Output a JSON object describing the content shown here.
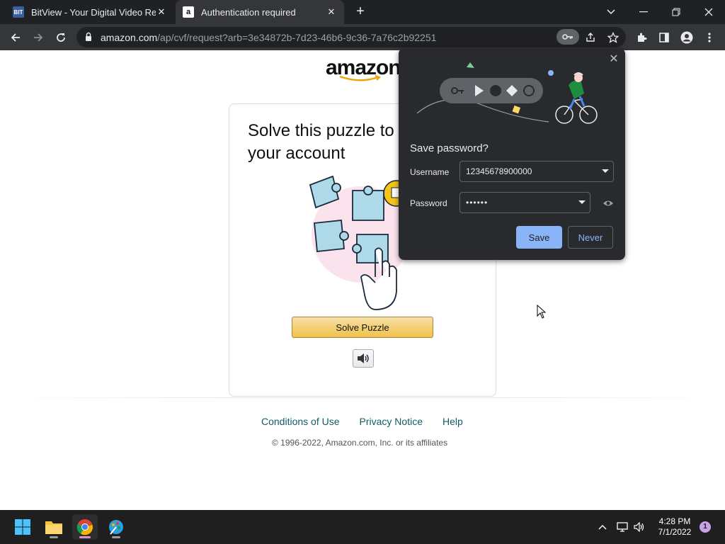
{
  "browser": {
    "tabs": [
      {
        "title": "BitView - Your Digital Video Repository",
        "favicon": "bitview-favicon",
        "active": false
      },
      {
        "title": "Authentication required",
        "favicon": "amazon-favicon",
        "active": true
      }
    ],
    "new_tab_label": "+",
    "address": {
      "host": "amazon.com",
      "path": "/ap/cvf/request?arb=3e34872b-7d23-46b6-9c36-7a76c2b92251"
    }
  },
  "page": {
    "logo_text": "amazon",
    "card_title": "Solve this puzzle to protect your account",
    "solve_button": "Solve Puzzle",
    "footer": {
      "links": [
        "Conditions of Use",
        "Privacy Notice",
        "Help"
      ],
      "copyright": "© 1996-2022, Amazon.com, Inc. or its affiliates"
    }
  },
  "password_bubble": {
    "title": "Save password?",
    "username_label": "Username",
    "username_value": "12345678900000",
    "password_label": "Password",
    "password_value": "••••••",
    "save_button": "Save",
    "never_button": "Never",
    "accent_color": "#8ab4f8"
  },
  "taskbar": {
    "time": "4:28 PM",
    "date": "7/1/2022",
    "notification_count": "1"
  }
}
